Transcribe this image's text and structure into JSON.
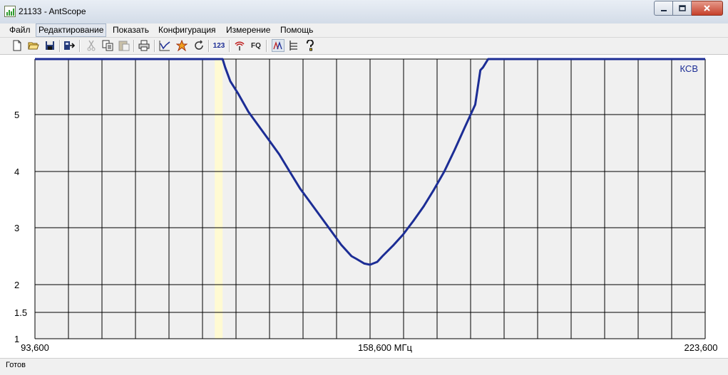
{
  "window": {
    "title": "21133 - AntScope",
    "minimize_icon": "minimize-icon",
    "maximize_icon": "maximize-icon",
    "close_icon": "close-icon"
  },
  "menu": {
    "items": [
      {
        "label": "Файл"
      },
      {
        "label": "Редактирование"
      },
      {
        "label": "Показать"
      },
      {
        "label": "Конфигурация"
      },
      {
        "label": "Измерение"
      },
      {
        "label": "Помощь"
      }
    ],
    "active_index": 1
  },
  "toolbar": {
    "buttons": [
      {
        "icon": "new-file-icon"
      },
      {
        "icon": "open-folder-icon"
      },
      {
        "icon": "save-icon"
      },
      {
        "icon": "export-icon"
      },
      {
        "icon": "cut-icon"
      },
      {
        "icon": "copy-icon"
      },
      {
        "icon": "paste-icon"
      },
      {
        "icon": "print-icon"
      },
      {
        "icon": "graph-icon"
      },
      {
        "icon": "marker-icon"
      },
      {
        "icon": "refresh-icon"
      },
      {
        "icon": "numeric-icon",
        "text": "123"
      },
      {
        "icon": "antenna-icon"
      },
      {
        "icon": "frequency-icon",
        "text": "FQ"
      },
      {
        "icon": "curves-icon"
      },
      {
        "icon": "list-icon"
      },
      {
        "icon": "help-icon"
      }
    ]
  },
  "chart_data": {
    "type": "line",
    "series": [
      {
        "name": "КСВ",
        "color": "#1c2d95",
        "x": [
          93.6,
          130.0,
          130.5,
          131.5,
          133.0,
          135.0,
          137.0,
          139.0,
          141.0,
          143.0,
          145.0,
          147.0,
          149.0,
          151.0,
          153.0,
          155.0,
          156.0,
          157.5,
          158.6,
          160.0,
          161.0,
          163.0,
          165.0,
          167.0,
          169.0,
          171.0,
          173.0,
          175.0,
          177.0,
          179.0,
          180.0,
          180.5,
          181.5,
          223.6
        ],
        "y": [
          6.0,
          6.0,
          5.85,
          5.6,
          5.38,
          5.05,
          4.8,
          4.55,
          4.3,
          4.0,
          3.7,
          3.45,
          3.2,
          2.95,
          2.7,
          2.5,
          2.45,
          2.37,
          2.35,
          2.4,
          2.5,
          2.68,
          2.88,
          3.12,
          3.38,
          3.68,
          4.0,
          4.38,
          4.78,
          5.18,
          5.8,
          5.85,
          6.0,
          6.0
        ]
      }
    ],
    "xlim": [
      93.6,
      223.6
    ],
    "x_ticks": [
      {
        "value": 93.6,
        "label": "93,600"
      },
      {
        "value": 158.6,
        "label": "158,600 МГц"
      },
      {
        "value": 223.6,
        "label": "223,600"
      }
    ],
    "x_grid_count": 20,
    "y_tick_labels": [
      "1",
      "1.5",
      "2",
      "3",
      "4",
      "5"
    ],
    "highlight_x": 130.0,
    "grid": true,
    "legend_placement": "top-right",
    "colors": {
      "line": "#1c2d95",
      "grid": "#000000",
      "plot_bg": "#f0f0f0",
      "highlight": "#fffad2"
    }
  },
  "status": {
    "text": "Готов"
  }
}
